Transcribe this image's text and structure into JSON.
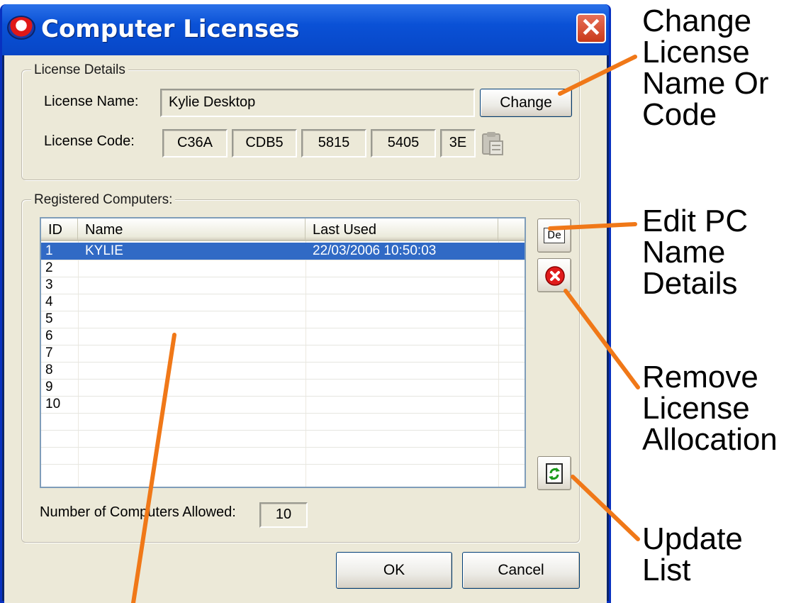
{
  "window": {
    "title": "Computer Licenses",
    "close_glyph": "✕"
  },
  "license_details": {
    "group_label": "License Details",
    "name_label": "License Name:",
    "name_value": "Kylie Desktop",
    "change_button": "Change",
    "code_label": "License Code:",
    "code_parts": [
      "C36A",
      "CDB5",
      "5815",
      "5405",
      "3E"
    ]
  },
  "registered": {
    "group_label": "Registered Computers:",
    "columns": [
      "ID",
      "Name",
      "Last Used"
    ],
    "rows": [
      {
        "id": "1",
        "name": "KYLIE",
        "last_used": "22/03/2006 10:50:03",
        "selected": true
      },
      {
        "id": "2",
        "name": "",
        "last_used": ""
      },
      {
        "id": "3",
        "name": "",
        "last_used": ""
      },
      {
        "id": "4",
        "name": "",
        "last_used": ""
      },
      {
        "id": "5",
        "name": "",
        "last_used": ""
      },
      {
        "id": "6",
        "name": "",
        "last_used": ""
      },
      {
        "id": "7",
        "name": "",
        "last_used": ""
      },
      {
        "id": "8",
        "name": "",
        "last_used": ""
      },
      {
        "id": "9",
        "name": "",
        "last_used": ""
      },
      {
        "id": "10",
        "name": "",
        "last_used": ""
      }
    ],
    "edit_button_text": "De",
    "allowed_label": "Number of Computers Allowed:",
    "allowed_value": "10"
  },
  "footer": {
    "ok_button": "OK",
    "cancel_button": "Cancel"
  },
  "annotations": {
    "change": [
      "Change",
      "License",
      "Name Or",
      "Code"
    ],
    "edit": [
      "Edit PC",
      "Name",
      "Details"
    ],
    "remove": [
      "Remove",
      "License",
      "Allocation"
    ],
    "update": [
      "Update",
      "List"
    ]
  },
  "colors": {
    "annotation_line": "#f07818",
    "selection": "#316ac5",
    "titlebar": "#0a51d6"
  },
  "icons": {
    "paste": "clipboard-icon",
    "remove": "red-x-icon",
    "refresh": "refresh-icon",
    "app": "app-logo-icon"
  }
}
